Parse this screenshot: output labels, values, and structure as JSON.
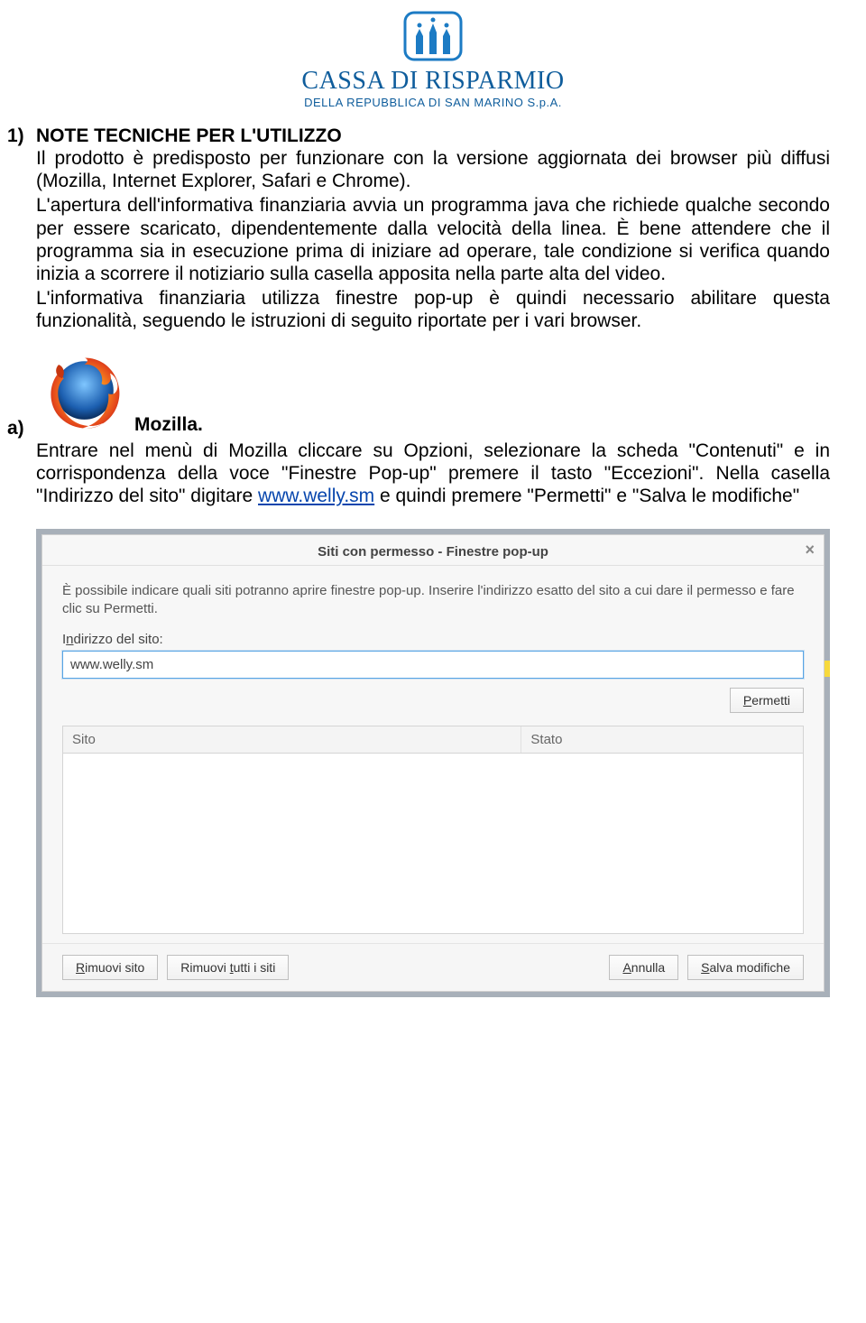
{
  "logo": {
    "line1": "CASSA DI RISPARMIO",
    "line2": "DELLA REPUBBLICA DI SAN MARINO S.p.A."
  },
  "section1": {
    "num": "1)",
    "title": "NOTE TECNICHE PER L'UTILIZZO",
    "p1": "Il prodotto è predisposto per funzionare con la versione aggiornata dei browser più diffusi (Mozilla, Internet Explorer, Safari e Chrome).",
    "p2": "L'apertura dell'informativa finanziaria avvia un programma java che richiede qualche secondo per essere scaricato, dipendentemente dalla velocità della linea. È bene attendere che il programma sia in esecuzione prima di iniziare ad operare, tale condizione si verifica quando inizia a scorrere il notiziario sulla casella apposita nella parte alta del video.",
    "p3": "L'informativa finanziaria utilizza finestre pop-up è quindi necessario abilitare questa funzionalità, seguendo le istruzioni di seguito riportate per i vari browser."
  },
  "sub_a": {
    "num": "a)",
    "title": "Mozilla.",
    "p_before_link": "Entrare nel menù di Mozilla cliccare su Opzioni, selezionare la scheda \"Contenuti\" e in corrispondenza della voce \"Finestre Pop-up\" premere il tasto \"Eccezioni\". Nella casella \"Indirizzo del sito\" digitare ",
    "link_text": "www.welly.sm",
    "p_after_link": " e quindi premere \"Permetti\" e \"Salva le modifiche\""
  },
  "dialog": {
    "title": "Siti con permesso - Finestre pop-up",
    "close": "×",
    "desc": "È possibile indicare quali siti potranno aprire finestre pop-up. Inserire l'indirizzo esatto del sito a cui dare il permesso e fare clic su Permetti.",
    "input_label_pre": "I",
    "input_label_ul": "n",
    "input_label_post": "dirizzo del sito:",
    "input_value": "www.welly.sm",
    "permetti_pre": "",
    "permetti_ul": "P",
    "permetti_post": "ermetti",
    "col_sito": "Sito",
    "col_stato": "Stato",
    "rimuovi_sito_pre": "",
    "rimuovi_sito_ul": "R",
    "rimuovi_sito_post": "imuovi sito",
    "rimuovi_tutti_pre": "Rimuovi ",
    "rimuovi_tutti_ul": "t",
    "rimuovi_tutti_post": "utti i siti",
    "annulla_pre": "",
    "annulla_ul": "A",
    "annulla_post": "nnulla",
    "salva_pre": "",
    "salva_ul": "S",
    "salva_post": "alva modifiche"
  }
}
